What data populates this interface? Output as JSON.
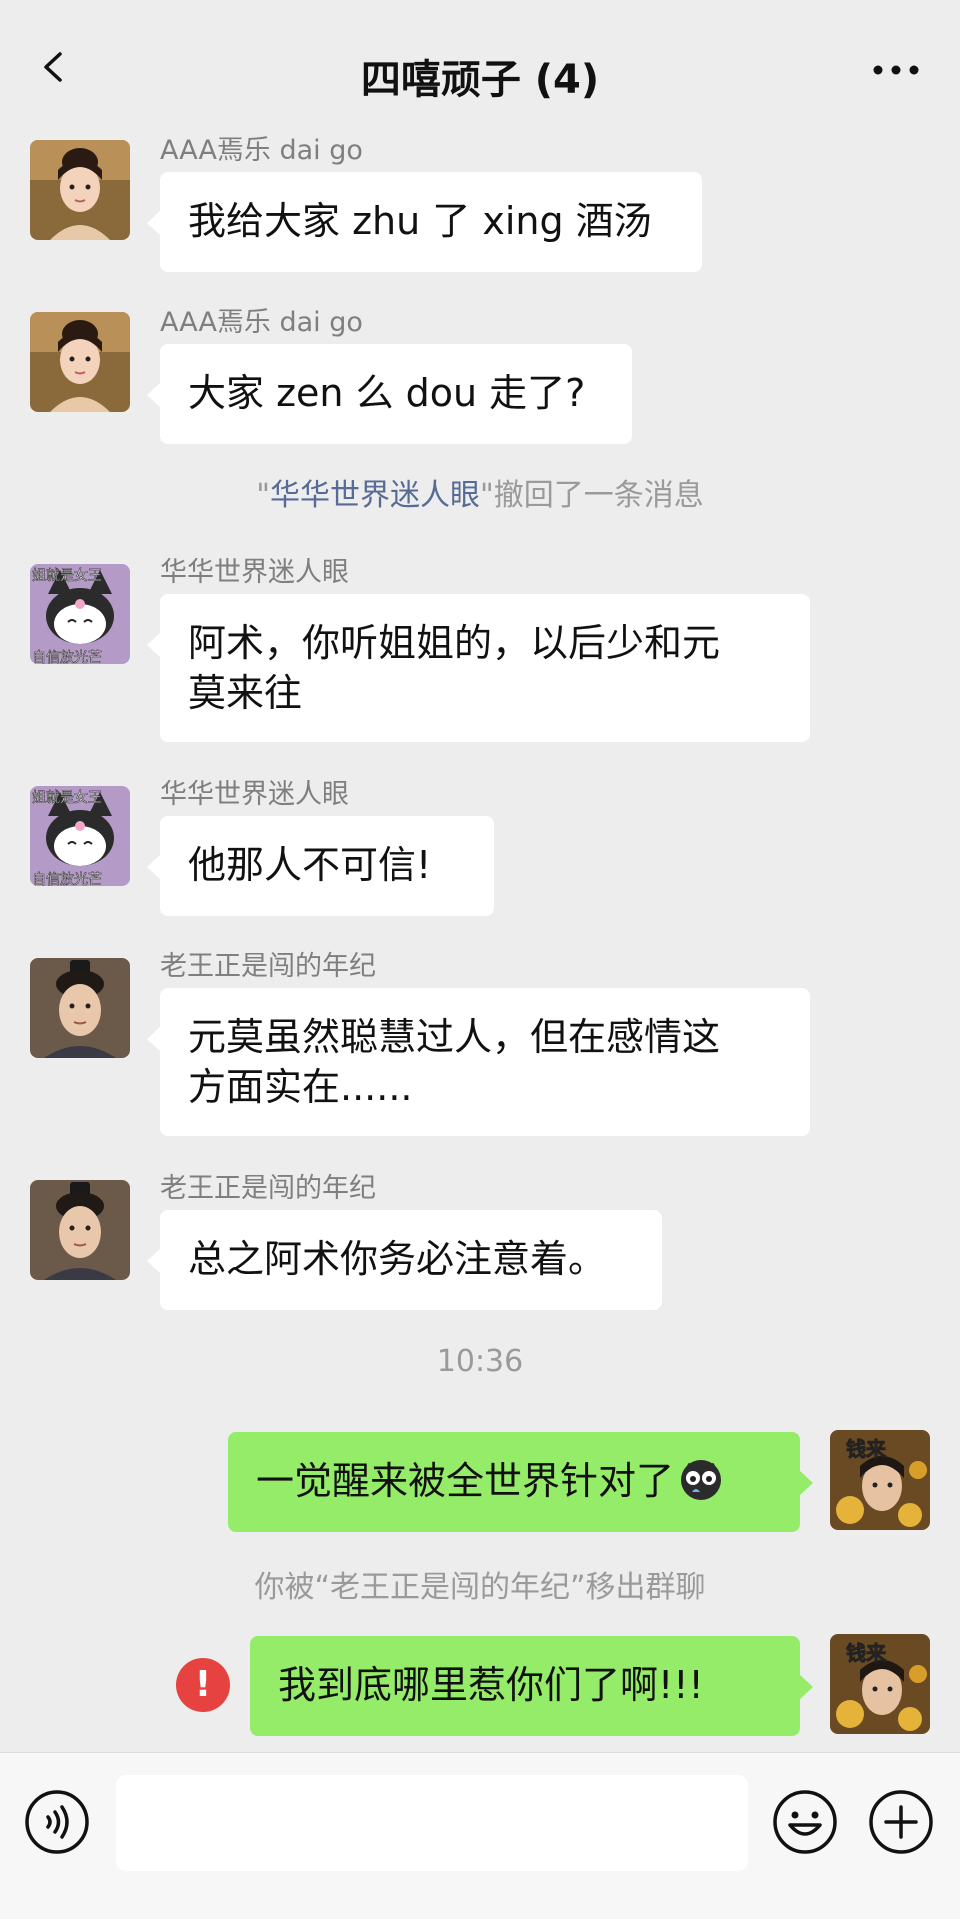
{
  "header": {
    "title": "四嘻顽子 (4)"
  },
  "messages": [
    {
      "sender": "AAA焉乐 dai go",
      "text": "我给大家 zhu 了 xing 酒汤"
    },
    {
      "sender": "AAA焉乐 dai go",
      "text": "大家 zen 么 dou 走了?"
    },
    {
      "recall_quote_open": "\"",
      "recall_name": "华华世界迷人眼",
      "recall_suffix": "\"撤回了一条消息"
    },
    {
      "sender": "华华世界迷人眼",
      "text_line1": "阿术，你听姐姐的，以后少和元",
      "text_line2": "莫来往"
    },
    {
      "sender": "华华世界迷人眼",
      "text": "他那人不可信!"
    },
    {
      "sender": "老王正是闯的年纪",
      "text_line1": "元莫虽然聪慧过人，但在感情这",
      "text_line2": "方面实在......"
    },
    {
      "sender": "老王正是闯的年纪",
      "text": "总之阿术你务必注意着。"
    },
    {
      "timestamp": "10:36"
    },
    {
      "text": "一觉醒来被全世界针对了"
    },
    {
      "system": "你被“老王正是闯的年纪”移出群聊"
    },
    {
      "text": "我到底哪里惹你们了啊!!!"
    }
  ],
  "avatars": {
    "girl_label": "girl-avatar",
    "kuromi_top_text": "姐就是女王",
    "kuromi_bottom_text": "自信放光芒",
    "me_badge": "钱来"
  },
  "error_mark": "!",
  "colors": {
    "my_bubble": "#95ec69",
    "other_bubble": "#ffffff",
    "background": "#ededed",
    "error": "#e64340",
    "link": "#576b95"
  }
}
